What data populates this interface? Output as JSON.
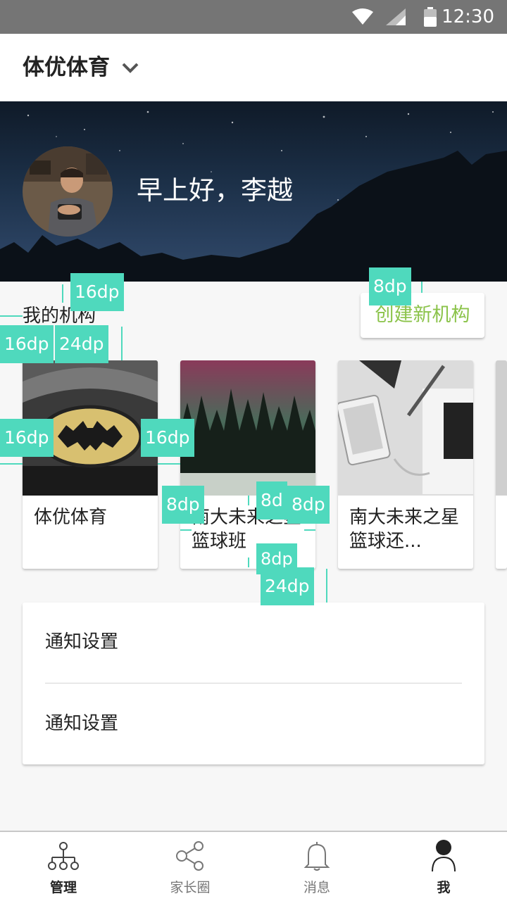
{
  "status_bar": {
    "time": "12:30"
  },
  "header": {
    "title": "体优体育"
  },
  "hero": {
    "greeting": "早上好，李越"
  },
  "organizations": {
    "section_title": "我的机构",
    "create_button": "创建新机构",
    "accent_color": "#8bc34a",
    "cards": [
      {
        "label": "体优体育"
      },
      {
        "label": "南大未来之星篮球班"
      },
      {
        "label": "南大未来之星篮球还..."
      }
    ]
  },
  "settings": {
    "items": [
      {
        "label": "通知设置"
      },
      {
        "label": "通知设置"
      }
    ]
  },
  "bottom_nav": {
    "items": [
      {
        "label": "管理",
        "icon": "org-chart-icon",
        "active": true
      },
      {
        "label": "家长圈",
        "icon": "share-icon",
        "active": false
      },
      {
        "label": "消息",
        "icon": "bell-icon",
        "active": false
      },
      {
        "label": "我",
        "icon": "person-icon",
        "active": true
      }
    ]
  },
  "annotations": {
    "a1": "16dp",
    "a2": "8dp",
    "a3": "16dp",
    "a4": "24dp",
    "a5": "16dp",
    "a6": "16dp",
    "a7": "8dp",
    "a8": "8d",
    "a9": "8dp",
    "a10": "8dp",
    "a11": "24dp",
    "color": "#4fd9bd"
  }
}
